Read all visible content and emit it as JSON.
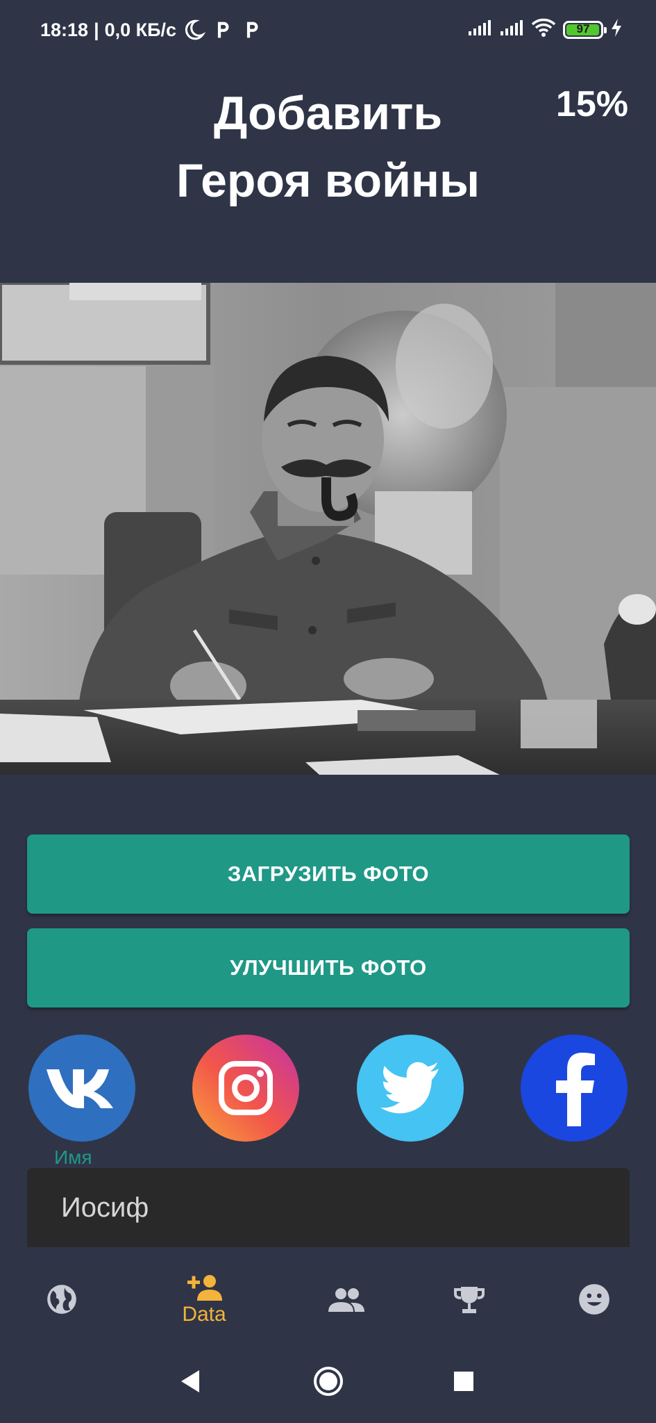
{
  "status_bar": {
    "time": "18:18",
    "network_speed": "0,0 КБ/с",
    "icons_left": [
      "moon-icon",
      "p-app-icon",
      "p-app-icon"
    ],
    "icons_right": [
      "signal-icon",
      "signal-icon",
      "wifi-icon",
      "battery-icon",
      "charging-icon"
    ],
    "battery_percent": "97"
  },
  "header": {
    "title_line1": "Добавить",
    "title_line2": "Героя войны",
    "progress": "15%"
  },
  "photo": {
    "icon": "hero-photo"
  },
  "buttons": {
    "upload_label": "ЗАГРУЗИТЬ ФОТО",
    "enhance_label": "УЛУЧШИТЬ ФОТО"
  },
  "social": [
    {
      "name": "vk",
      "icon": "vk-icon"
    },
    {
      "name": "instagram",
      "icon": "instagram-icon"
    },
    {
      "name": "twitter",
      "icon": "twitter-icon"
    },
    {
      "name": "facebook",
      "icon": "facebook-icon"
    }
  ],
  "form": {
    "name_label": "Имя",
    "name_value": "Иосиф"
  },
  "bottom_nav": {
    "items": [
      {
        "icon": "globe-icon",
        "label": "",
        "active": false
      },
      {
        "icon": "add-person-icon",
        "label": "Data",
        "active": true
      },
      {
        "icon": "people-icon",
        "label": "",
        "active": false
      },
      {
        "icon": "trophy-icon",
        "label": "",
        "active": false
      },
      {
        "icon": "smiley-icon",
        "label": "",
        "active": false
      }
    ]
  },
  "system_nav": [
    "back-icon",
    "home-icon",
    "recents-icon"
  ],
  "colors": {
    "background": "#2f3547",
    "accent_button": "#1f9886",
    "nav_active": "#f4b33a",
    "nav_inactive": "#c9ccd4",
    "field_background": "#292929"
  }
}
